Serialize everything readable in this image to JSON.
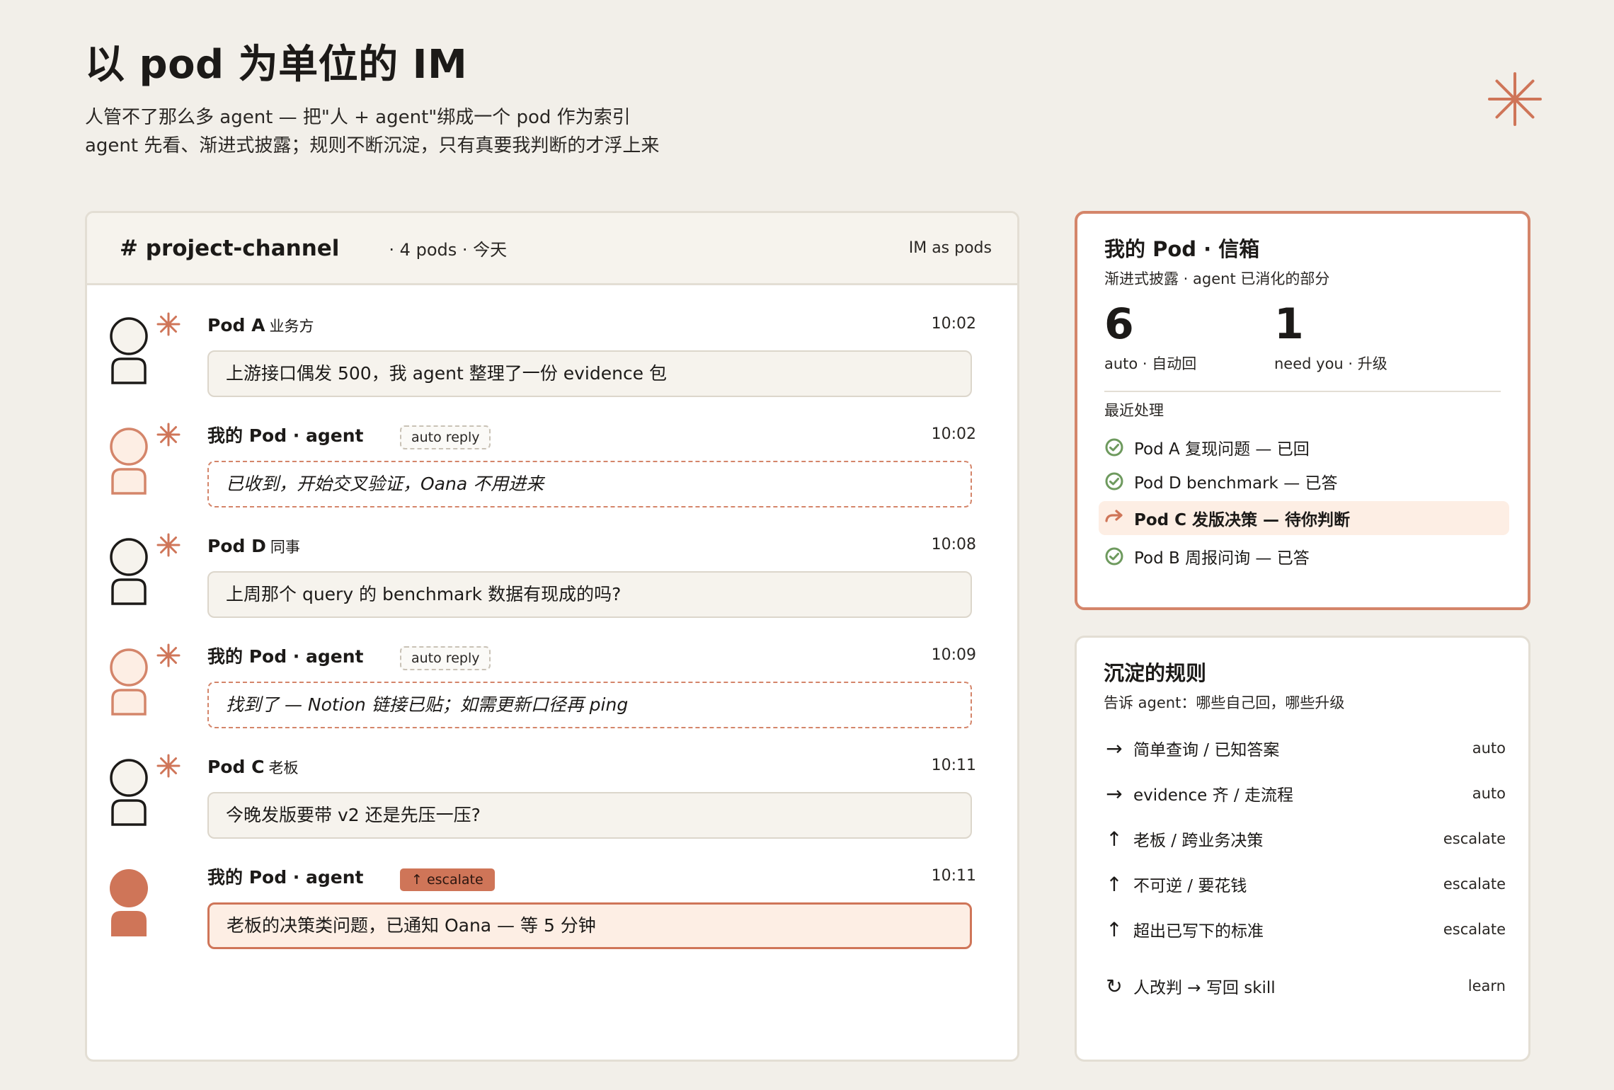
{
  "header": {
    "title": "以 pod 为单位的 IM",
    "subtitle_line1": "人管不了那么多 agent — 把\"人 + agent\"绑成一个 pod 作为索引",
    "subtitle_line2": "agent 先看、渐进式披露；规则不断沉淀，只有真要我判断的才浮上来"
  },
  "colors": {
    "accent": "#cf7558",
    "accent_soft": "#fdeee4",
    "ink": "#1c1a18",
    "check_green": "#6e9a5e"
  },
  "channel": {
    "name": "# project-channel",
    "meta": "· 4 pods · 今天",
    "tag": "IM as pods"
  },
  "messages": [
    {
      "sender": "Pod A",
      "role": "业务方",
      "time": "10:02",
      "text": "上游接口偶发 500，我 agent 整理了一份 evidence 包",
      "kind": "human"
    },
    {
      "sender": "我的 Pod · agent",
      "role": "",
      "badge": "auto reply",
      "time": "10:02",
      "text": "已收到，开始交叉验证，Oana 不用进来",
      "kind": "auto"
    },
    {
      "sender": "Pod D",
      "role": "同事",
      "time": "10:08",
      "text": "上周那个 query 的 benchmark 数据有现成的吗?",
      "kind": "human"
    },
    {
      "sender": "我的 Pod · agent",
      "role": "",
      "badge": "auto reply",
      "time": "10:09",
      "text": "找到了 — Notion 链接已贴；如需更新口径再 ping",
      "kind": "auto"
    },
    {
      "sender": "Pod C",
      "role": "老板",
      "time": "10:11",
      "text": "今晚发版要带 v2 还是先压一压?",
      "kind": "human"
    },
    {
      "sender": "我的 Pod · agent",
      "role": "",
      "badge": "↑ escalate",
      "time": "10:11",
      "text": "老板的决策类问题，已通知 Oana — 等 5 分钟",
      "kind": "escalate"
    }
  ],
  "inbox": {
    "title": "我的 Pod · 信箱",
    "subtitle": "渐进式披露 · agent 已消化的部分",
    "stats": [
      {
        "value": "6",
        "label": "auto · 自动回"
      },
      {
        "value": "1",
        "label": "need you · 升级"
      }
    ],
    "recent_label": "最近处理",
    "recent": [
      {
        "text": "Pod A 复现问题 — 已回",
        "status": "done"
      },
      {
        "text": "Pod D benchmark — 已答",
        "status": "done"
      },
      {
        "text": "Pod C 发版决策 — 待你判断",
        "status": "pending"
      },
      {
        "text": "Pod B 周报问询 — 已答",
        "status": "done"
      }
    ]
  },
  "rules": {
    "title": "沉淀的规则",
    "subtitle": "告诉 agent：哪些自己回，哪些升级",
    "items": [
      {
        "arrow": "→",
        "text": "简单查询 / 已知答案",
        "tag": "auto"
      },
      {
        "arrow": "→",
        "text": "evidence 齐 / 走流程",
        "tag": "auto"
      },
      {
        "arrow": "↑",
        "text": "老板 / 跨业务决策",
        "tag": "escalate"
      },
      {
        "arrow": "↑",
        "text": "不可逆 / 要花钱",
        "tag": "escalate"
      },
      {
        "arrow": "↑",
        "text": "超出已写下的标准",
        "tag": "escalate"
      },
      {
        "arrow": "↻",
        "text": "人改判 → 写回 skill",
        "tag": "learn"
      }
    ]
  }
}
